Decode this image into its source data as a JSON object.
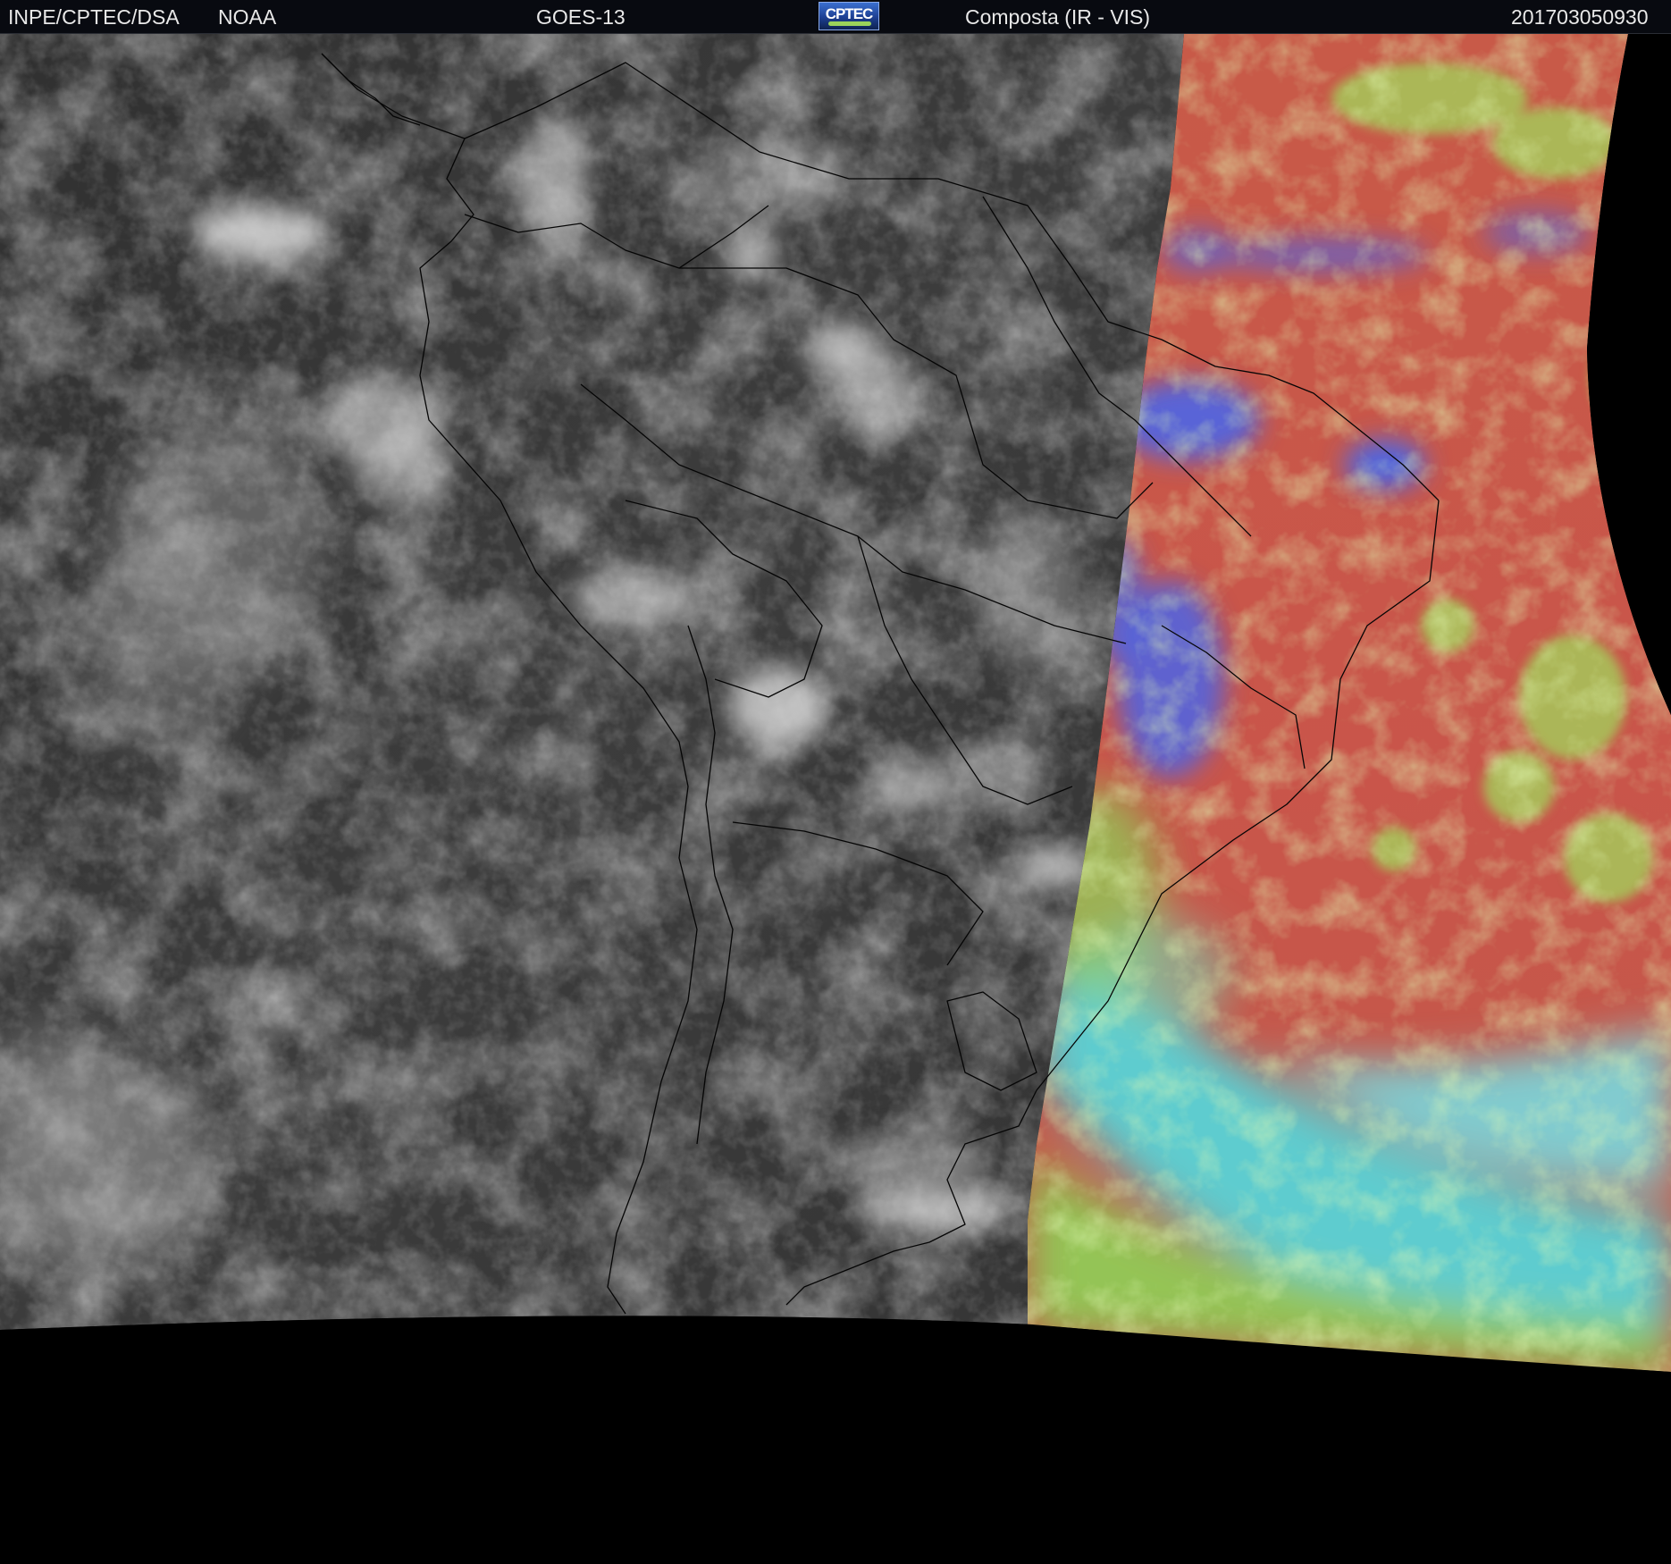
{
  "header": {
    "institution": "INPE/CPTEC/DSA",
    "agency": "NOAA",
    "satellite": "GOES-13",
    "product": "Composta (IR - VIS)",
    "timestamp": "201703050930",
    "logo_text": "CPTEC"
  },
  "map": {
    "region": "South America",
    "left_panel": "infrared grayscale",
    "right_panel": "visible false-color composite",
    "colors": {
      "background": "#000000",
      "ir_base": "#3a3a3a",
      "vis_warm": "#c9564a",
      "vis_cloud_cyan": "#54d8e4",
      "vis_green": "#9ccb55",
      "vis_blue": "#3f6ef2"
    }
  }
}
